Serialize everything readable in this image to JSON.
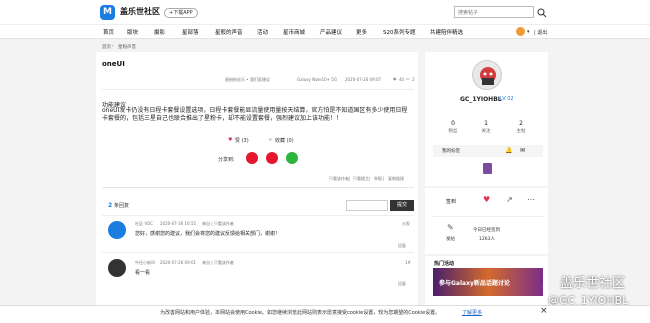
{
  "header": {
    "logo_mark": "M",
    "brand": "盖乐世社区",
    "download": "+下载APP",
    "search_placeholder": "搜索帖子"
  },
  "nav": [
    "首页",
    "版块",
    "摄影",
    "星部落",
    "星般的声音",
    "活动",
    "星币商城",
    "产品建议",
    "更多",
    "S20系列专题",
    "共建陪伴精选"
  ],
  "user": {
    "menu": "▾",
    "logout": "| 退出"
  },
  "breadcrumb": [
    "首页",
    "›",
    "星粉声音"
  ],
  "post": {
    "title": "oneUI",
    "author": "星粉粉丝乐 • 我们家建议",
    "device": "Galaxy Note10+ 5G",
    "date": "2020-07-26 09:07",
    "views": "40",
    "comments": "2",
    "body_1": "功能建议",
    "body_2": "oneUI发卡仍没有日程卡套餐设置选项，日程卡套餐能显流量使用量按天结算，官方怕是不知道国区有多少使用日程卡套餐的，包括三星自己也联合推出了星粉卡，却不能设置套餐，强烈建议加上该功能！！",
    "like": "赞 (3)",
    "fav": "收藏 (0)",
    "share_label": "分享到:",
    "ops": [
      "只看该作者",
      "|",
      "只看楼主",
      "|",
      "举报",
      "|",
      "复制链接"
    ]
  },
  "comments": {
    "count": "2",
    "count_label": "条回复",
    "search_btn": "提交",
    "items": [
      {
        "user": "社区-VOC",
        "date": "2020-07-30 16:55",
        "tag": "来自 | 只看该作者",
        "floor": "沙发",
        "text": "您好，感谢您的建议，我们会将您的建议反馈给相关部门，谢谢！",
        "reply": "回复"
      },
      {
        "user": "中还小新叫",
        "date": "2020-07-26 09:01",
        "tag": "来自 | 只看该作者",
        "floor": "1#",
        "text": "看一看",
        "reply": "回复"
      }
    ]
  },
  "sidebar": {
    "username": "GC_1YIOHBL",
    "level": "LV 02",
    "stats": [
      {
        "num": "0",
        "label": "粉丝"
      },
      {
        "num": "1",
        "label": "关注"
      },
      {
        "num": "2",
        "label": "主帖"
      }
    ],
    "my_tag": "我的标签",
    "sign_in": "签到",
    "today_label": "今日已经签到",
    "today_count": "1263人",
    "share_count": "发帖",
    "hot_title": "热门活动",
    "ad_text": "参与Galaxy新品话题讨论"
  },
  "watermark": {
    "line1": "盖乐世社区",
    "line2": "@GC_1YIOHBL"
  },
  "cookie": {
    "text": "为改善网站和用户体验，本网站会使用Cookie。如您继续浏览此网站则表示愿意接受cookie设置，较为您期望的Cookie设置。",
    "link": "了解更多",
    "close": "×"
  },
  "colors": {
    "brand_blue": "#1a7de0",
    "like_red": "#e0355a",
    "level_blue": "#1a7de0"
  }
}
